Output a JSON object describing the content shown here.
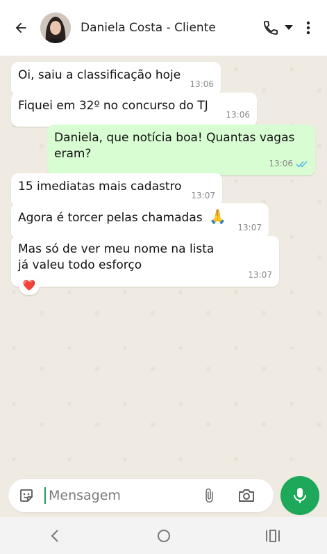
{
  "header": {
    "contact_name": "Daniela Costa - Cliente",
    "icons": [
      "back-arrow-icon",
      "avatar",
      "phone-icon",
      "chevron-down-icon",
      "more-vertical-icon"
    ]
  },
  "messages": [
    {
      "direction": "incoming",
      "text": "Oi, saiu a classificação hoje",
      "time": "13:06"
    },
    {
      "direction": "incoming",
      "text": "Fiquei em 32º no concurso do TJ",
      "time": "13:06"
    },
    {
      "direction": "outgoing",
      "text": "Daniela, que notícia boa! Quantas vagas eram?",
      "time": "13:06",
      "status": "read"
    },
    {
      "direction": "incoming",
      "text": "15 imediatas mais cadastro",
      "time": "13:07"
    },
    {
      "direction": "incoming",
      "text": "Agora é torcer pelas chamadas",
      "emoji": "🙏",
      "time": "13:07"
    },
    {
      "direction": "incoming",
      "text": "Mas só de ver meu nome na lista já valeu todo esforço",
      "time": "13:07",
      "reaction": "❤️"
    }
  ],
  "composer": {
    "placeholder": "Mensagem",
    "value": ""
  },
  "colors": {
    "chat_bg": "#efeae2",
    "outgoing_bubble": "#d9fdd3",
    "incoming_bubble": "#ffffff",
    "mic_button": "#1da85a",
    "read_ticks": "#53bdeb"
  }
}
